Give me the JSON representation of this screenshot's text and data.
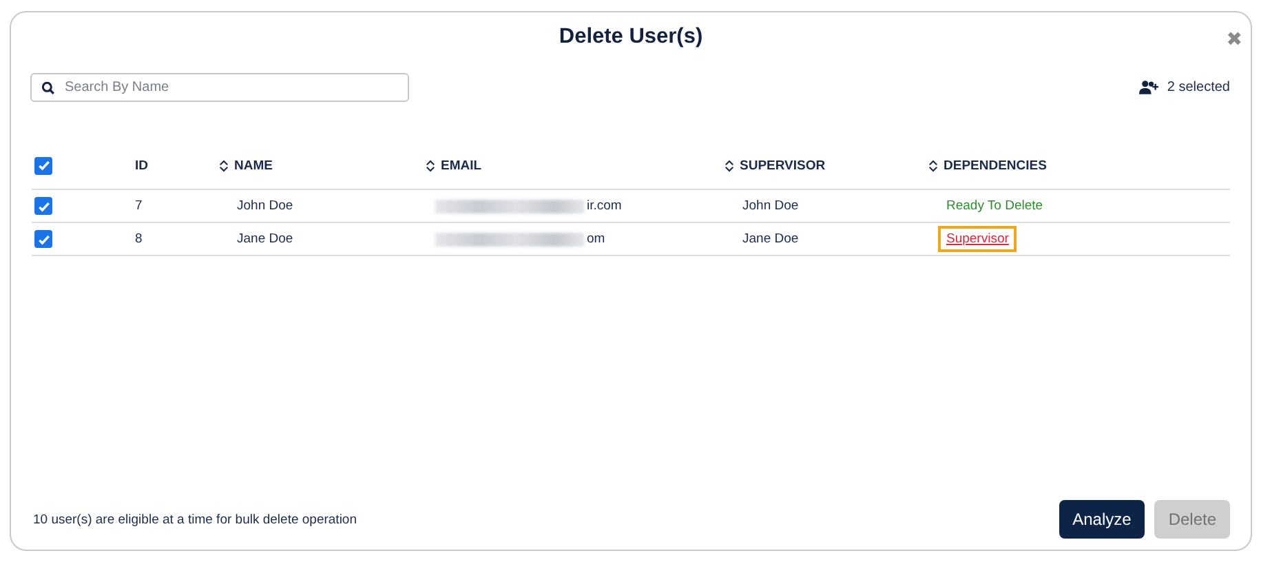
{
  "dialog": {
    "title": "Delete User(s)",
    "close": "✖"
  },
  "search": {
    "placeholder": "Search By Name"
  },
  "selection": {
    "count": "2 selected"
  },
  "table": {
    "all_checked": true,
    "columns": [
      {
        "label": "ID",
        "sortable": false
      },
      {
        "label": "NAME",
        "sortable": true
      },
      {
        "label": "EMAIL",
        "sortable": true
      },
      {
        "label": "SUPERVISOR",
        "sortable": true
      },
      {
        "label": "DEPENDENCIES",
        "sortable": true
      }
    ],
    "rows": [
      {
        "checked": true,
        "id": "7",
        "name": "John Doe",
        "email": "ir.com",
        "supervisor": "John Doe",
        "dependency": {
          "kind": "ready",
          "text": "Ready To Delete"
        }
      },
      {
        "checked": true,
        "id": "8",
        "name": "Jane Doe",
        "email": "om",
        "supervisor": "Jane Doe",
        "dependency": {
          "kind": "link",
          "text": "Supervisor"
        }
      }
    ]
  },
  "footer": {
    "note": "10 user(s) are eligible at a time for bulk delete operation",
    "buttons": [
      {
        "label": "Analyze",
        "disabled": false
      },
      {
        "label": "Delete",
        "disabled": true
      }
    ]
  }
}
